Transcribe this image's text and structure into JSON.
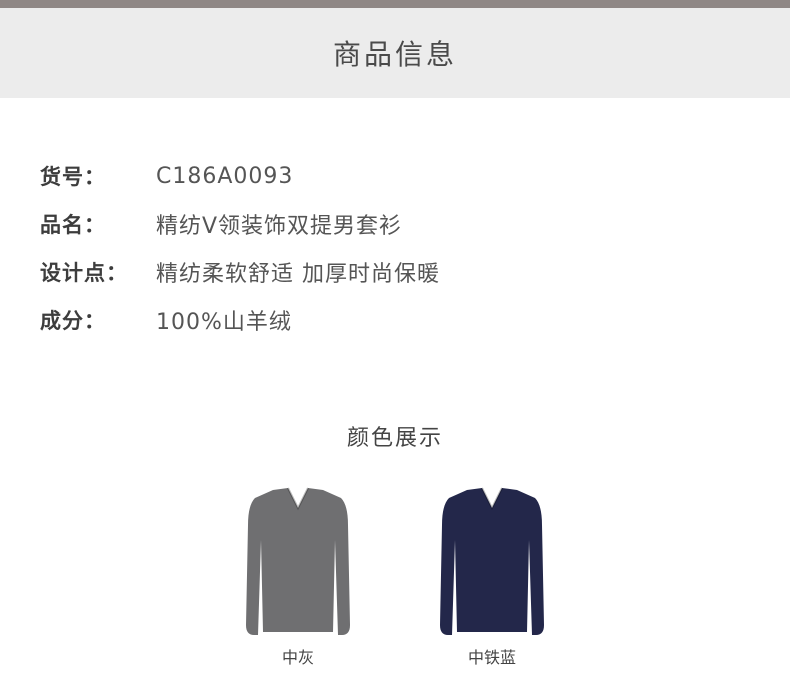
{
  "header": {
    "title": "商品信息"
  },
  "info": [
    {
      "label": "货号：",
      "value": "C186A0093"
    },
    {
      "label": "品名：",
      "value": "精纺V领装饰双提男套衫"
    },
    {
      "label": "设计点：",
      "value": "精纺柔软舒适 加厚时尚保暖"
    },
    {
      "label": "成分：",
      "value": "100%山羊绒"
    }
  ],
  "colors": {
    "title": "颜色展示",
    "items": [
      {
        "name": "中灰",
        "color": "#6f6f71"
      },
      {
        "name": "中铁蓝",
        "color": "#23274a"
      }
    ]
  }
}
